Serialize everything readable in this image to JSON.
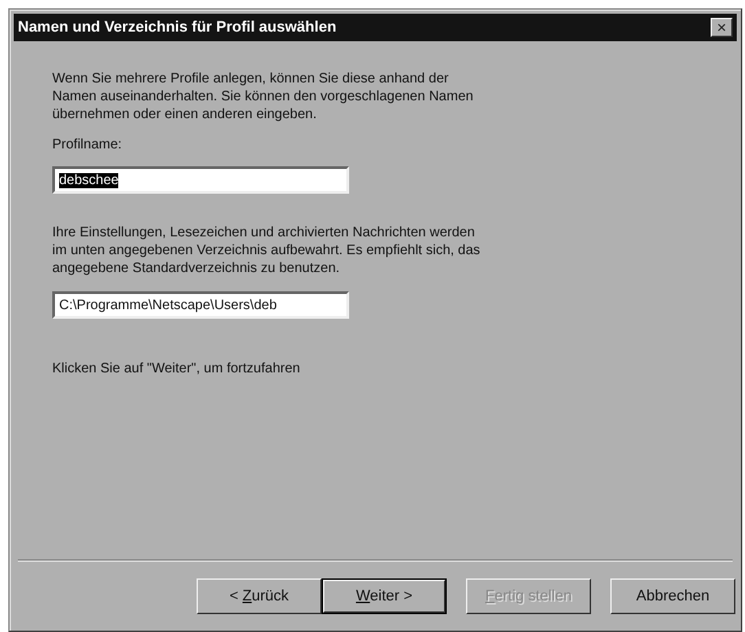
{
  "window": {
    "title": "Namen und Verzeichnis für Profil auswählen",
    "close_glyph": "×"
  },
  "intro_lines": [
    "Wenn Sie mehrere Profile anlegen, können Sie diese anhand der",
    "Namen auseinanderhalten. Sie können den vorgeschlagenen Namen",
    "übernehmen oder einen anderen eingeben."
  ],
  "name_field": {
    "label": "Profilname:",
    "value": "debschee",
    "text_selected": true
  },
  "folder_info_lines": [
    "Ihre Einstellungen, Lesezeichen und archivierten Nachrichten werden",
    "im unten angegebenen Verzeichnis aufbewahrt. Es empfiehlt sich, das",
    "angegebene Standardverzeichnis zu benutzen."
  ],
  "folder_field": {
    "value": "C:\\Programme\\Netscape\\Users\\deb"
  },
  "hint": "Klicken Sie auf \"Weiter\", um fortzufahren",
  "buttons": [
    {
      "before": "< ",
      "mnemonic": "Z",
      "after": "urück",
      "default": false,
      "disabled": false
    },
    {
      "mnemonic": "W",
      "after": "eiter >",
      "default": true,
      "disabled": false
    },
    {
      "mnemonic": "F",
      "after": "ertig stellen",
      "default": false,
      "disabled": true
    },
    {
      "before": "Abbrechen",
      "default": false,
      "disabled": false
    }
  ]
}
